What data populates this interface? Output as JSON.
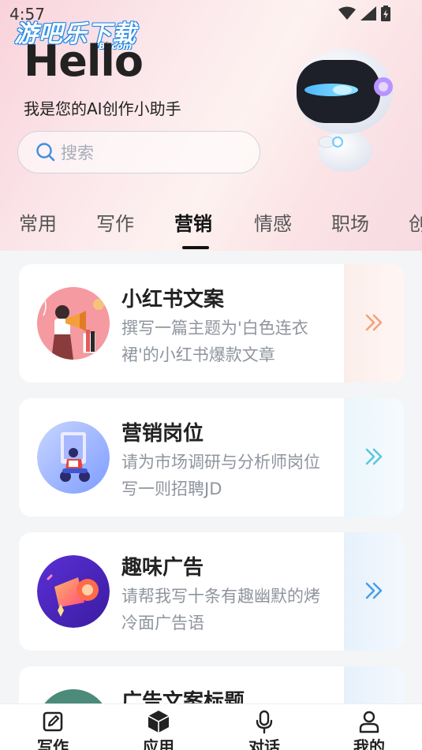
{
  "status_bar": {
    "time": "4:57"
  },
  "watermark": {
    "main": "游吧乐下载",
    "sub": "yBl.com"
  },
  "header": {
    "greeting": "Hello",
    "subtitle": "我是您的AI创作小助手"
  },
  "search": {
    "placeholder": "搜索"
  },
  "tabs": [
    {
      "label": "常用",
      "active": false
    },
    {
      "label": "写作",
      "active": false
    },
    {
      "label": "营销",
      "active": true
    },
    {
      "label": "情感",
      "active": false
    },
    {
      "label": "职场",
      "active": false
    },
    {
      "label": "创",
      "active": false
    }
  ],
  "cards": [
    {
      "title": "小红书文案",
      "desc": "撰写一篇主题为'白色连衣裙'的小红书爆款文章",
      "accent": "#f4a07a"
    },
    {
      "title": "营销岗位",
      "desc": "请为市场调研与分析师岗位写一则招聘JD",
      "accent": "#5cc6e0"
    },
    {
      "title": "趣味广告",
      "desc": "请帮我写十条有趣幽默的烤冷面广告语",
      "accent": "#4a9fe8"
    },
    {
      "title": "广告文案标题",
      "desc": "",
      "accent": "#4a9fe8"
    }
  ],
  "bottom_nav": [
    {
      "label": "写作",
      "icon": "edit-icon"
    },
    {
      "label": "应用",
      "icon": "cube-icon",
      "active": true
    },
    {
      "label": "对话",
      "icon": "microphone-icon"
    },
    {
      "label": "我的",
      "icon": "person-icon"
    }
  ]
}
